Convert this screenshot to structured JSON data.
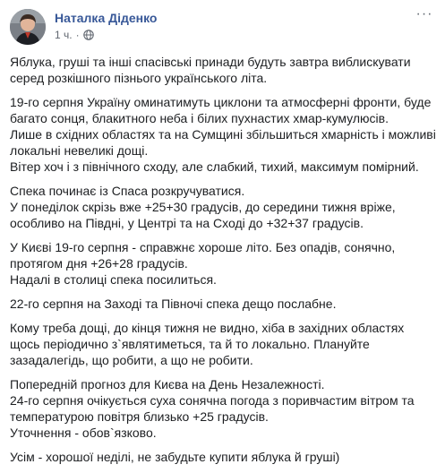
{
  "post": {
    "author": "Наталка Діденко",
    "time": "1 ч.",
    "separator": "·",
    "more_label": "···",
    "paragraphs": [
      "Яблука, груші та інші спасівські принади будуть завтра виблискувати\nсеред розкішного пізнього українського літа.",
      "19-го серпня Україну оминатимуть циклони та атмосферні фронти, буде\nбагато сонця, блакитного неба і білих пухнастих хмар-кумулюсів.\nЛише в східних областях та на Сумщині збільшиться хмарність і можливі\nлокальні невеликі дощі.\nВітер хоч і з північного сходу, але слабкий, тихий, максимум помірний.",
      "Спека починає із Спаса розкручуватися.\nУ понеділок скрізь вже +25+30 градусів, до середини тижня вріже,\nособливо на Півдні, у Центрі та на Сході до +32+37 градусів.",
      "У Києві 19-го серпня - справжнє хороше літо. Без опадів, сонячно,\nпротягом дня +26+28 градусів.\nНадалі в столиці спека посилиться.",
      "22-го серпня на Заході та Півночі спека дещо послабне.",
      "Кому треба дощі, до кінця тижня не видно, хіба в західних областях\nщось періодично з`являтиметься, та й то локально. Плануйте\nзазадалегідь, що робити, а що не робити.",
      "Попередній прогноз для Києва на День Незалежності.\n24-го серпня очікується суха сонячна погода з поривчастим вітром та\nтемпературою повітря близько +25 градусів.\nУточнення - обов`язково.",
      "Усім - хорошої неділі, не забудьте купити яблука й груші)"
    ]
  }
}
